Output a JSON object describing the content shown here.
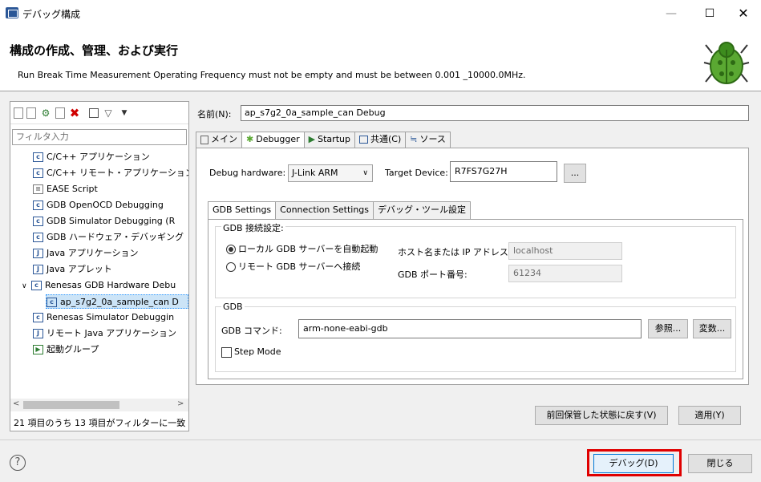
{
  "window": {
    "title": "デバッグ構成",
    "min": "—",
    "max": "☐",
    "close": "✕"
  },
  "header": {
    "title": "構成の作成、管理、および実行",
    "message": "Run Break Time Measurement Operating Frequency must not be empty and must be between 0.001 _10000.0MHz."
  },
  "left": {
    "filter_placeholder": "フィルタ入力",
    "tree": [
      {
        "icon": "c",
        "label": "C/C++ アプリケーション"
      },
      {
        "icon": "c",
        "label": "C/C++ リモート・アプリケーション"
      },
      {
        "icon": "doc",
        "label": "EASE Script"
      },
      {
        "icon": "c",
        "label": "GDB OpenOCD Debugging"
      },
      {
        "icon": "c",
        "label": "GDB Simulator Debugging (R"
      },
      {
        "icon": "c",
        "label": "GDB ハードウェア・デバッギング"
      },
      {
        "icon": "j",
        "label": "Java アプリケーション"
      },
      {
        "icon": "j",
        "label": "Java アプレット"
      },
      {
        "icon": "c",
        "label": "Renesas GDB Hardware Debu"
      },
      {
        "icon": "c",
        "label": "ap_s7g2_0a_sample_can D"
      },
      {
        "icon": "c",
        "label": "Renesas Simulator Debuggin"
      },
      {
        "icon": "j",
        "label": "リモート Java アプリケーション"
      },
      {
        "icon": "grn",
        "label": "起動グループ"
      }
    ],
    "status": "21 項目のうち 13 項目がフィルターに一致"
  },
  "right": {
    "name_label": "名前(N):",
    "name_value": "ap_s7g2_0a_sample_can Debug",
    "tabs": [
      "メイン",
      "Debugger",
      "Startup",
      "共通(C)",
      "ソース"
    ],
    "debug_hw_label": "Debug hardware:",
    "debug_hw_value": "J-Link ARM",
    "target_device_label": "Target Device:",
    "target_device_value": "R7FS7G27H",
    "browse_label": "...",
    "subtabs": [
      "GDB Settings",
      "Connection Settings",
      "デバッグ・ツール設定"
    ],
    "gdb_conn_group": "GDB 接続設定:",
    "radio_local": "ローカル GDB サーバーを自動起動",
    "radio_remote": "リモート GDB サーバーへ接続",
    "host_label": "ホスト名または IP アドレス:",
    "host_value": "localhost",
    "port_label": "GDB ポート番号:",
    "port_value": "61234",
    "gdb_group": "GDB",
    "gdb_cmd_label": "GDB コマンド:",
    "gdb_cmd_value": "arm-none-eabi-gdb",
    "browse_btn": "参照...",
    "vars_btn": "変数...",
    "step_mode": "Step Mode",
    "revert_btn": "前回保管した状態に戻す(V)",
    "apply_btn": "適用(Y)"
  },
  "footer": {
    "help": "?",
    "debug_btn": "デバッグ(D)",
    "close_btn": "閉じる"
  }
}
